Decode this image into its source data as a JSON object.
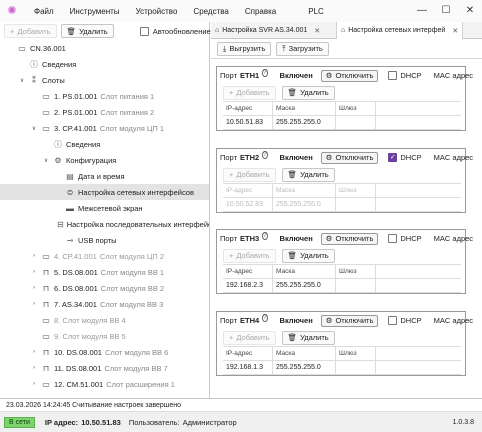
{
  "menu": [
    "Файл",
    "Инструменты",
    "Устройство",
    "Средства",
    "Справка",
    "PLC"
  ],
  "left_toolbar": {
    "add": "Добавить",
    "delete": "Удалить",
    "autorefresh": "Автообновление"
  },
  "tree": [
    {
      "l": "CN.36.001",
      "s": "",
      "d": 0,
      "arr": "",
      "ic": "▭",
      "g": false,
      "sel": false
    },
    {
      "l": "Сведения",
      "s": "",
      "d": 1,
      "arr": "",
      "ic": "ⓘ",
      "g": false,
      "sel": false
    },
    {
      "l": "Слоты",
      "s": "",
      "d": 1,
      "arr": "∨",
      "ic": "⁑",
      "g": false,
      "sel": false
    },
    {
      "l": "1. PS.01.001",
      "s": "Слот питания 1",
      "d": 2,
      "arr": "",
      "ic": "▭",
      "g": false,
      "sel": false
    },
    {
      "l": "2. PS.01.001",
      "s": "Слот питания 2",
      "d": 2,
      "arr": "",
      "ic": "▭",
      "g": false,
      "sel": false
    },
    {
      "l": "3. CP.41.001",
      "s": "Слот модуля ЦП 1",
      "d": 2,
      "arr": "∨",
      "ic": "▭",
      "g": false,
      "sel": false
    },
    {
      "l": "Сведения",
      "s": "",
      "d": 3,
      "arr": "",
      "ic": "ⓘ",
      "g": false,
      "sel": false
    },
    {
      "l": "Конфигурация",
      "s": "",
      "d": 3,
      "arr": "∨",
      "ic": "⚙",
      "g": false,
      "sel": false
    },
    {
      "l": "Дата и время",
      "s": "",
      "d": 4,
      "arr": "",
      "ic": "▤",
      "g": false,
      "sel": false
    },
    {
      "l": "Настройка сетевых интерфейсов",
      "s": "",
      "d": 4,
      "arr": "",
      "ic": "⊜",
      "g": false,
      "sel": true
    },
    {
      "l": "Межсетевой экран",
      "s": "",
      "d": 4,
      "arr": "",
      "ic": "▬",
      "g": false,
      "sel": false
    },
    {
      "l": "Настройка последовательных интерфейсов",
      "s": "",
      "d": 4,
      "arr": "",
      "ic": "⊟",
      "g": false,
      "sel": false
    },
    {
      "l": "USB порты",
      "s": "",
      "d": 4,
      "arr": "",
      "ic": "⊸",
      "g": false,
      "sel": false
    },
    {
      "l": "4. CP.41.001",
      "s": "Слот модуля ЦП 2",
      "d": 2,
      "arr": "›",
      "ic": "▭",
      "g": true,
      "sel": false
    },
    {
      "l": "5. DS.08.001",
      "s": "Слот модуля ВВ 1",
      "d": 2,
      "arr": "›",
      "ic": "⊓",
      "g": false,
      "sel": false
    },
    {
      "l": "6. DS.08.001",
      "s": "Слот модуля ВВ 2",
      "d": 2,
      "arr": "›",
      "ic": "⊓",
      "g": false,
      "sel": false
    },
    {
      "l": "7. AS.34.001",
      "s": "Слот модуля ВВ 3",
      "d": 2,
      "arr": "›",
      "ic": "⊓",
      "g": false,
      "sel": false
    },
    {
      "l": "8. Слот модуля ВВ 4",
      "s": "",
      "d": 2,
      "arr": "",
      "ic": "▭",
      "g": true,
      "sel": false
    },
    {
      "l": "9. Слот модуля ВВ 5",
      "s": "",
      "d": 2,
      "arr": "",
      "ic": "▭",
      "g": true,
      "sel": false
    },
    {
      "l": "10. DS.08.001",
      "s": "Слот модуля ВВ 6",
      "d": 2,
      "arr": "›",
      "ic": "⊓",
      "g": false,
      "sel": false
    },
    {
      "l": "11. DS.08.001",
      "s": "Слот модуля ВВ 7",
      "d": 2,
      "arr": "›",
      "ic": "⊓",
      "g": false,
      "sel": false
    },
    {
      "l": "12. CM.51.001",
      "s": "Слот расширения 1",
      "d": 2,
      "arr": "›",
      "ic": "▭",
      "g": false,
      "sel": false
    }
  ],
  "tabs": [
    {
      "label": "Настройка SVR AS.34.001"
    },
    {
      "label": "Настройка сетевых интерфей"
    }
  ],
  "right_toolbar": {
    "upload": "Выгрузить",
    "download": "Загрузить"
  },
  "port_labels": {
    "port": "Порт",
    "enabled": "Включен",
    "disable": "Отключить",
    "dhcp": "DHCP",
    "mac": "MAC адрес",
    "add": "Добавить",
    "delete": "Удалить",
    "ip": "IP-адрес",
    "mask": "Маска",
    "gateway": "Шлюз"
  },
  "ports": [
    {
      "name": "ETH1",
      "dhcp": false,
      "ip": "10.50.51.83",
      "mask": "255.255.255.0",
      "gw": ""
    },
    {
      "name": "ETH2",
      "dhcp": true,
      "ip": "10.50.52.83",
      "mask": "255.255.255.0",
      "gw": ""
    },
    {
      "name": "ETH3",
      "dhcp": false,
      "ip": "192.168.2.3",
      "mask": "255.255.255.0",
      "gw": ""
    },
    {
      "name": "ETH4",
      "dhcp": false,
      "ip": "192.168.1.3",
      "mask": "255.255.255.0",
      "gw": ""
    }
  ],
  "status_line": "23.03.2026 14:24:45 Считывание настроек завершено",
  "footer": {
    "network": "В сети",
    "ip_label": "IP адрес:",
    "ip_value": "10.50.51.83",
    "user_label": "Пользователь:",
    "user_value": "Администратор",
    "version": "1.0.3.8"
  }
}
